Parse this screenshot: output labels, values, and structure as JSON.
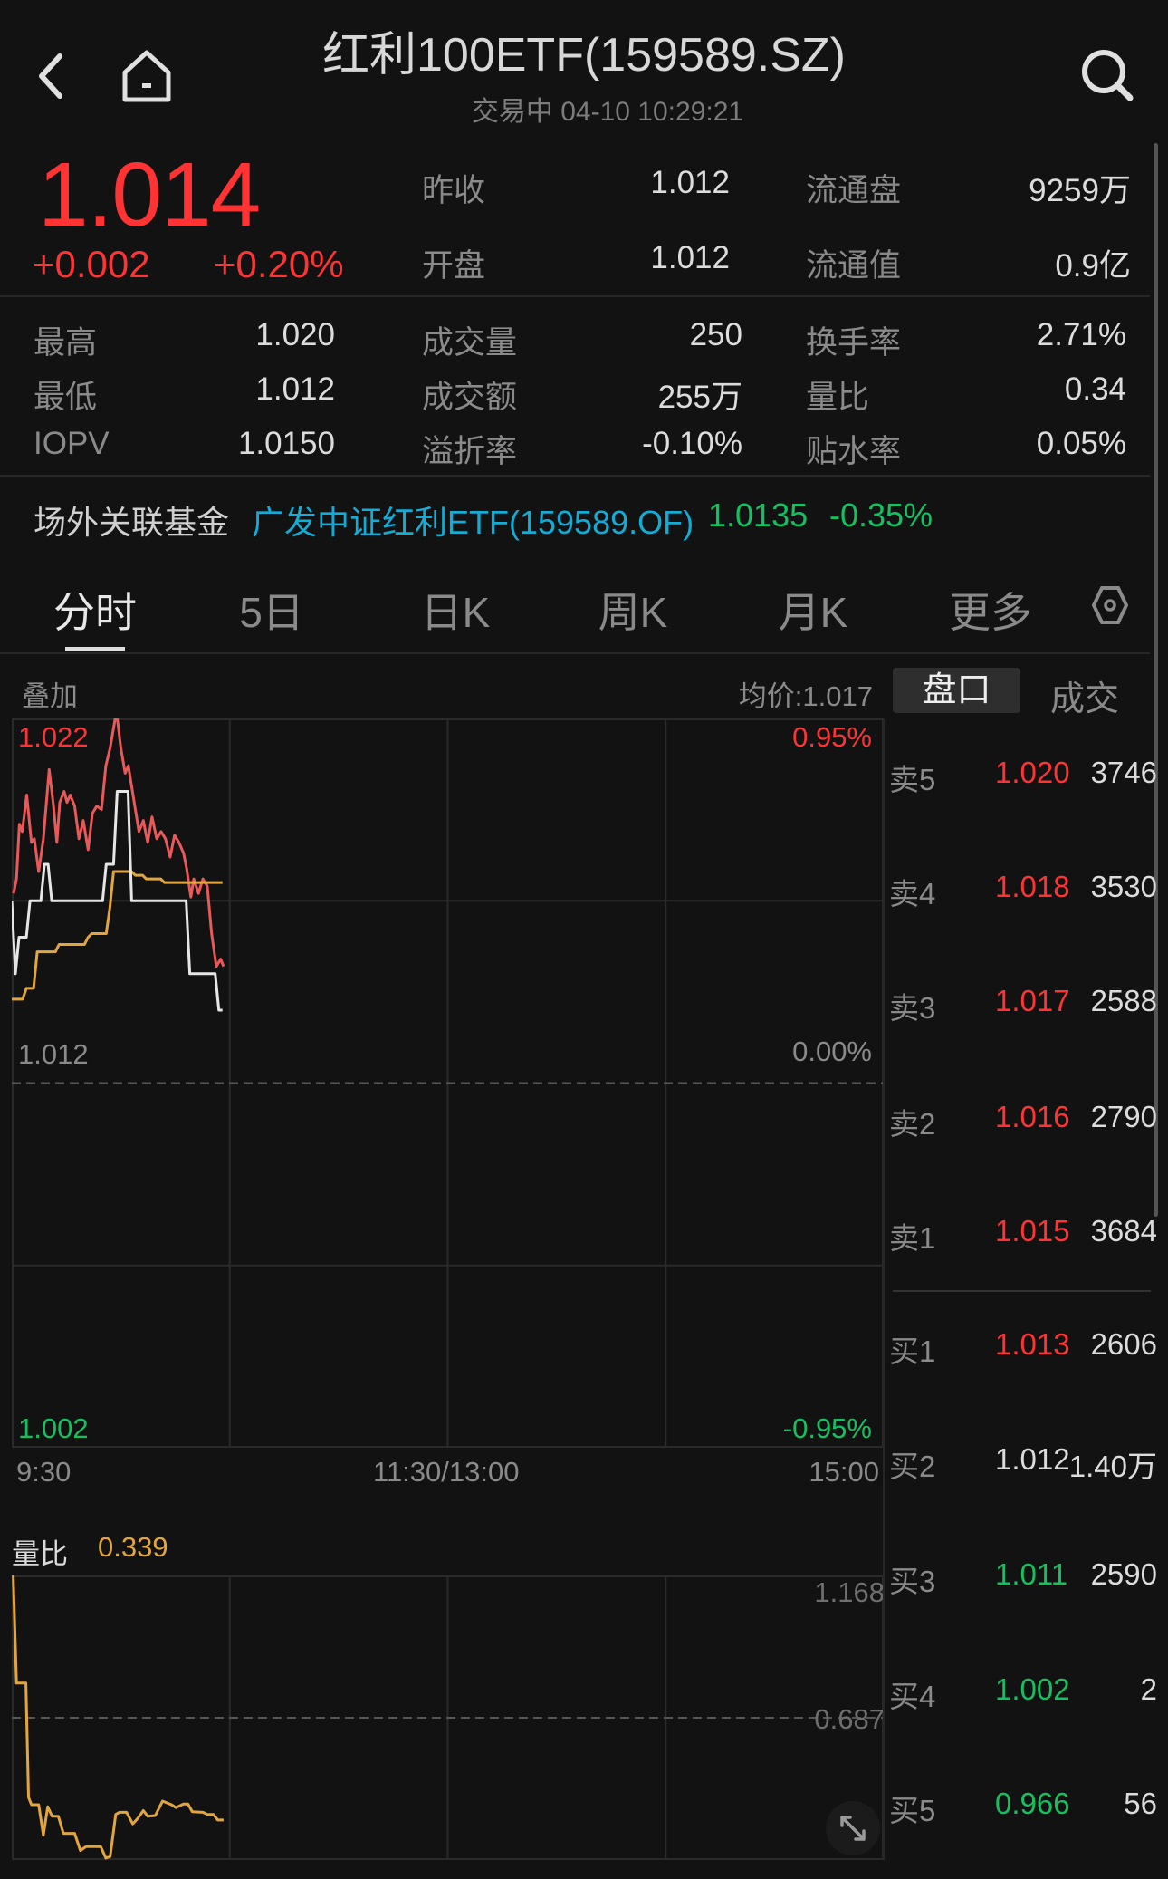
{
  "header": {
    "title": "红利100ETF(159589.SZ)",
    "status": "交易中 04-10 10:29:21"
  },
  "quote": {
    "price": "1.014",
    "change": "+0.002",
    "change_pct": "+0.20%"
  },
  "stats": [
    {
      "label": "昨收",
      "value": "1.012",
      "color": "normal"
    },
    {
      "label": "流通盘",
      "value": "9259万",
      "color": "normal"
    },
    {
      "label": "开盘",
      "value": "1.012",
      "color": "normal"
    },
    {
      "label": "流通值",
      "value": "0.9亿",
      "color": "normal"
    }
  ],
  "grid": [
    [
      {
        "label": "最高",
        "value": "1.020",
        "color": "normal"
      },
      {
        "label": "成交量",
        "value": "250",
        "color": "normal"
      },
      {
        "label": "换手率",
        "value": "2.71%",
        "color": "normal"
      }
    ],
    [
      {
        "label": "最低",
        "value": "1.012",
        "color": "normal"
      },
      {
        "label": "成交额",
        "value": "255万",
        "color": "normal"
      },
      {
        "label": "量比",
        "value": "0.34",
        "color": "normal"
      }
    ],
    [
      {
        "label": "IOPV",
        "value": "1.0150",
        "color": "normal"
      },
      {
        "label": "溢折率",
        "value": "-0.10%",
        "color": "green"
      },
      {
        "label": "贴水率",
        "value": "0.05%",
        "color": "red"
      }
    ]
  ],
  "related": {
    "label": "场外关联基金",
    "fund": "广发中证红利ETF(159589.OF)",
    "price": "1.0135",
    "change": "-0.35%"
  },
  "tabs": [
    "分时",
    "5日",
    "日K",
    "周K",
    "月K",
    "更多"
  ],
  "chart_header": {
    "overlay": "叠加",
    "avg": "均价:1.017",
    "book_tabs": [
      "盘口",
      "成交"
    ]
  },
  "chart_data": [
    {
      "type": "line",
      "title": "分时",
      "ylim": [
        1.002,
        1.022
      ],
      "y_labels_left": [
        "1.022",
        "1.012",
        "1.002"
      ],
      "y_labels_right": [
        "0.95%",
        "0.00%",
        "-0.95%"
      ],
      "x_ticks": [
        "9:30",
        "11:30/13:00",
        "15:00"
      ],
      "x_range_minutes": [
        0,
        240
      ],
      "series": [
        {
          "name": "price",
          "color": "#e6e6e6",
          "x_start": 0,
          "values": [
            1.017,
            1.015,
            1.016,
            1.016,
            1.016,
            1.017,
            1.017,
            1.017,
            1.017,
            1.018,
            1.018,
            1.017,
            1.017,
            1.017,
            1.017,
            1.017,
            1.017,
            1.017,
            1.017,
            1.017,
            1.017,
            1.017,
            1.017,
            1.017,
            1.017,
            1.017,
            1.018,
            1.018,
            1.018,
            1.02,
            1.02,
            1.02,
            1.02,
            1.017,
            1.017,
            1.017,
            1.017,
            1.017,
            1.017,
            1.017,
            1.017,
            1.017,
            1.017,
            1.017,
            1.017,
            1.017,
            1.017,
            1.017,
            1.017,
            1.015,
            1.015,
            1.015,
            1.015,
            1.015,
            1.015,
            1.015,
            1.015,
            1.014,
            1.014
          ]
        },
        {
          "name": "avg",
          "color": "#e3a63f",
          "x_start": 0,
          "values": [
            1.0143,
            1.0143,
            1.0143,
            1.0143,
            1.0146,
            1.0146,
            1.0146,
            1.0156,
            1.0156,
            1.0156,
            1.0156,
            1.0156,
            1.0156,
            1.0158,
            1.0158,
            1.0158,
            1.0158,
            1.0158,
            1.0158,
            1.0158,
            1.0158,
            1.016,
            1.0161,
            1.0161,
            1.0161,
            1.0161,
            1.0161,
            1.0168,
            1.0178,
            1.0178,
            1.0178,
            1.0178,
            1.0178,
            1.0178,
            1.0177,
            1.0177,
            1.0177,
            1.0176,
            1.0176,
            1.0176,
            1.0176,
            1.0176,
            1.0175,
            1.0175,
            1.0175,
            1.0175,
            1.0175,
            1.0175,
            1.0175,
            1.0175,
            1.0175,
            1.0175,
            1.0175,
            1.0175,
            1.0175,
            1.0175,
            1.0175,
            1.0175,
            1.0175
          ]
        },
        {
          "name": "overlay",
          "color": "#e85a5a",
          "x": [
            0.5,
            1.3,
            2.1,
            2.9,
            4.1,
            5.4,
            6.2,
            7.4,
            8.7,
            10.3,
            11.5,
            12.4,
            13.2,
            14.4,
            15.2,
            16.1,
            17.3,
            18.5,
            19.7,
            21,
            22.2,
            23.4,
            24.7,
            25.9,
            27.1,
            28.8,
            30,
            31.2,
            32.1,
            32.9,
            35,
            36.2,
            37.4,
            38.6,
            39.9,
            41.1,
            42.3,
            43.6,
            44.8,
            46,
            47.3,
            48.1,
            49.3,
            50.1,
            51.4,
            52.6,
            53.8,
            55,
            56.3,
            57.5,
            58.3
          ],
          "values": [
            1.0172,
            1.0176,
            1.0191,
            1.0189,
            1.0199,
            1.0186,
            1.0187,
            1.0178,
            1.0187,
            1.0206,
            1.0196,
            1.0186,
            1.0197,
            1.02,
            1.0197,
            1.0199,
            1.0196,
            1.0187,
            1.0192,
            1.0184,
            1.0194,
            1.0196,
            1.0195,
            1.0207,
            1.0212,
            1.0222,
            1.0212,
            1.0205,
            1.0207,
            1.0202,
            1.0189,
            1.0192,
            1.0186,
            1.0193,
            1.0187,
            1.0189,
            1.0187,
            1.0182,
            1.0188,
            1.0186,
            1.0183,
            1.0179,
            1.0171,
            1.0176,
            1.0172,
            1.0176,
            1.0174,
            1.0161,
            1.0152,
            1.0154,
            1.0152
          ]
        }
      ]
    },
    {
      "type": "line",
      "title": "量比",
      "current": "0.339",
      "ylim": [
        0.206,
        1.168
      ],
      "y_labels": [
        "1.168",
        "0.687"
      ],
      "series": [
        {
          "name": "量比",
          "color": "#e3a63f",
          "x": [
            0.4,
            1.3,
            3.9,
            4.6,
            5.4,
            7.4,
            8.7,
            9.9,
            11.1,
            12.8,
            14.2,
            17.3,
            18.9,
            20.4,
            24.5,
            25.9,
            27.1,
            28.6,
            29.6,
            31.6,
            33.3,
            34.7,
            36.2,
            37.4,
            39.5,
            41.5,
            44,
            45.2,
            47.2,
            48.5,
            49.7,
            52.6,
            53.8,
            55.5,
            56.7,
            58.3
          ],
          "values": [
            1.168,
            0.804,
            0.804,
            0.418,
            0.393,
            0.393,
            0.29,
            0.386,
            0.354,
            0.354,
            0.296,
            0.296,
            0.238,
            0.251,
            0.251,
            0.212,
            0.218,
            0.36,
            0.367,
            0.367,
            0.328,
            0.347,
            0.373,
            0.354,
            0.356,
            0.405,
            0.393,
            0.383,
            0.395,
            0.395,
            0.369,
            0.367,
            0.36,
            0.36,
            0.341,
            0.341
          ]
        }
      ]
    }
  ],
  "order_book": {
    "asks": [
      {
        "label": "卖5",
        "price": "1.020",
        "volume": "3746",
        "color": "red"
      },
      {
        "label": "卖4",
        "price": "1.018",
        "volume": "3530",
        "color": "red"
      },
      {
        "label": "卖3",
        "price": "1.017",
        "volume": "2588",
        "color": "red"
      },
      {
        "label": "卖2",
        "price": "1.016",
        "volume": "2790",
        "color": "red"
      },
      {
        "label": "卖1",
        "price": "1.015",
        "volume": "3684",
        "color": "red"
      }
    ],
    "bids": [
      {
        "label": "买1",
        "price": "1.013",
        "volume": "2606",
        "color": "red"
      },
      {
        "label": "买2",
        "price": "1.012",
        "volume": "1.40万",
        "color": "normal"
      },
      {
        "label": "买3",
        "price": "1.011",
        "volume": "2590",
        "color": "green"
      },
      {
        "label": "买4",
        "price": "1.002",
        "volume": "2",
        "color": "green"
      },
      {
        "label": "买5",
        "price": "0.966",
        "volume": "56",
        "color": "green"
      }
    ]
  },
  "colors": {
    "up": "#ff3333",
    "down": "#16c060",
    "link": "#12acd6",
    "avg": "#e3a63f",
    "bg": "#121212"
  }
}
